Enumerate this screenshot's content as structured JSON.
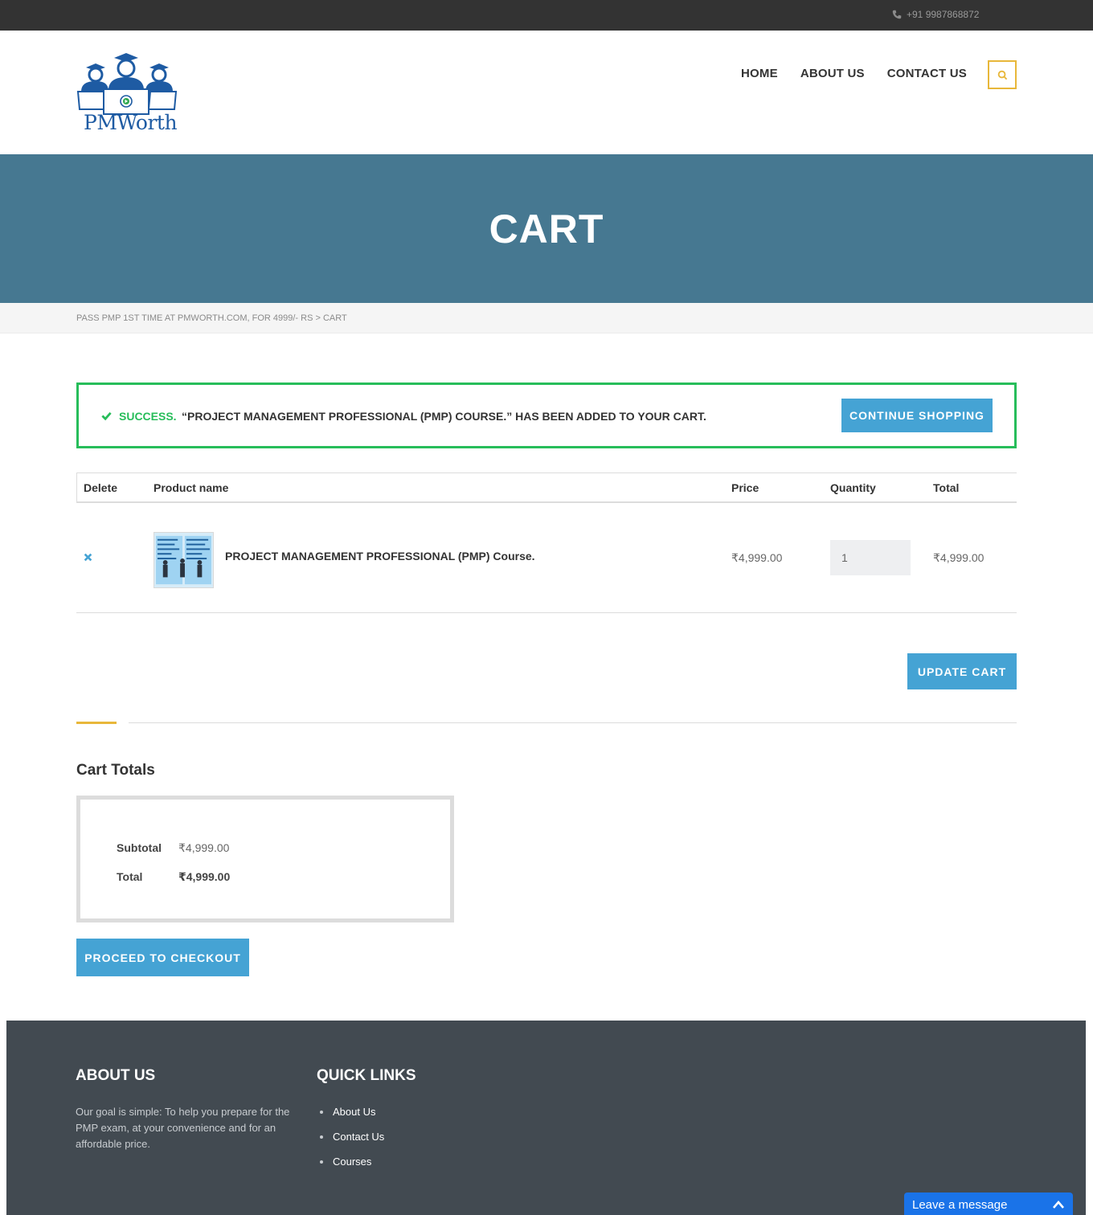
{
  "topbar": {
    "phone": "+91 9987868872",
    "phone_icon": "phone-icon"
  },
  "header": {
    "logo_text": "PMWorth",
    "nav": [
      "HOME",
      "ABOUT US",
      "CONTACT US"
    ],
    "search_icon": "search-icon",
    "accent": "#e8b73a"
  },
  "hero": {
    "title": "CART",
    "bg": "#467891"
  },
  "breadcrumb": {
    "text": "PASS PMP 1ST TIME AT PMWORTH.COM, FOR 4999/- RS > CART"
  },
  "notice": {
    "status": "SUCCESS.",
    "message": "“PROJECT MANAGEMENT PROFESSIONAL (PMP) COURSE.” HAS BEEN ADDED TO YOUR CART.",
    "button": "CONTINUE SHOPPING",
    "color": "#27bd5a"
  },
  "cart": {
    "columns": [
      "Delete",
      "Product name",
      "Price",
      "Quantity",
      "Total"
    ],
    "rows": [
      {
        "name": "PROJECT MANAGEMENT PROFESSIONAL (PMP) Course.",
        "price": "₹4,999.00",
        "quantity": "1",
        "total": "₹4,999.00"
      }
    ],
    "update_button": "UPDATE CART"
  },
  "totals": {
    "title": "Cart Totals",
    "subtotal_label": "Subtotal",
    "subtotal_value": "₹4,999.00",
    "total_label": "Total",
    "total_value": "₹4,999.00",
    "checkout_button": "PROCEED TO CHECKOUT"
  },
  "footer": {
    "about_title": "ABOUT US",
    "about_text": "Our goal is simple: To help you prepare for the PMP exam, at your convenience and for an affordable price.",
    "links_title": "QUICK LINKS",
    "links": [
      "About Us",
      "Contact Us",
      "Courses"
    ]
  },
  "chat": {
    "label": "Leave a message"
  },
  "colors": {
    "button_blue": "#45a3d4",
    "footer_bg": "#424a51",
    "topbar_bg": "#333333"
  }
}
